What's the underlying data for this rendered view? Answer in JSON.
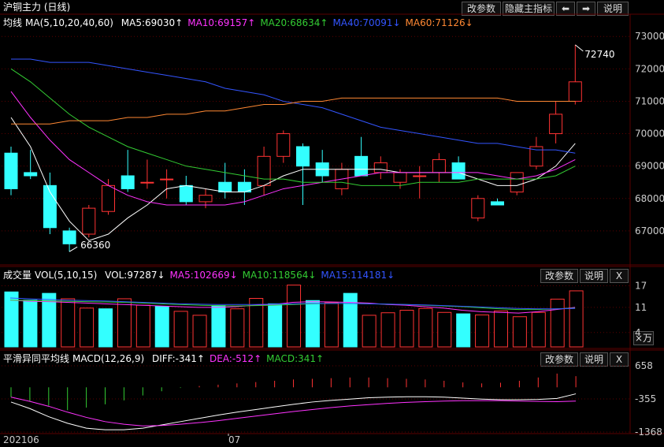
{
  "main": {
    "title": "沪铜主力 (日线)",
    "buttons": {
      "params": "改参数",
      "hide": "隐藏主指标",
      "explain": "说明"
    },
    "indicator": {
      "label": "均线",
      "params": "MA(5,10,20,40,60)",
      "items": [
        {
          "text": "MA5:69030↑",
          "color": "#ffffff"
        },
        {
          "text": "MA10:69157↑",
          "color": "#ff33ff"
        },
        {
          "text": "MA20:68634↑",
          "color": "#33cc33"
        },
        {
          "text": "MA40:70091↓",
          "color": "#3355ff"
        },
        {
          "text": "MA60:71126↓",
          "color": "#ff8833"
        }
      ]
    },
    "annotations": {
      "high": "72740",
      "low": "66360"
    }
  },
  "volume": {
    "title": "成交量",
    "params": "VOL(5,10,15)",
    "items": [
      {
        "text": "VOL:97287↓",
        "color": "#ffffff"
      },
      {
        "text": "MA5:102669↓",
        "color": "#ff33ff"
      },
      {
        "text": "MA10:118564↓",
        "color": "#33cc33"
      },
      {
        "text": "MA15:114181↓",
        "color": "#3355ff"
      }
    ],
    "buttons": {
      "params": "改参数",
      "explain": "说明",
      "close": "X",
      "unit": "×万"
    }
  },
  "macd": {
    "title": "平滑异同平均线",
    "params": "MACD(12,26,9)",
    "items": [
      {
        "text": "DIFF:-341↑",
        "color": "#ffffff"
      },
      {
        "text": "DEA:-512↑",
        "color": "#ff33ff"
      },
      {
        "text": "MACD:341↑",
        "color": "#33cc33"
      }
    ],
    "buttons": {
      "params": "改参数",
      "explain": "说明",
      "close": "X"
    }
  },
  "x_labels": [
    "202106",
    "07"
  ],
  "chart_data": [
    {
      "type": "candlestick",
      "ylim": [
        66000,
        73200
      ],
      "y_ticks": [
        67000,
        68000,
        69000,
        70000,
        71000,
        72000,
        73000
      ],
      "colors": {
        "up": "#ff3333",
        "down": "#33ffff",
        "grid": "#5a0000"
      },
      "candles": [
        {
          "o": 69400,
          "h": 69600,
          "l": 68100,
          "c": 68300
        },
        {
          "o": 68800,
          "h": 69500,
          "l": 68600,
          "c": 68700
        },
        {
          "o": 68400,
          "h": 68800,
          "l": 66900,
          "c": 67100
        },
        {
          "o": 67000,
          "h": 67100,
          "l": 66360,
          "c": 66600
        },
        {
          "o": 66900,
          "h": 67800,
          "l": 66800,
          "c": 67700
        },
        {
          "o": 67600,
          "h": 68600,
          "l": 67500,
          "c": 68400
        },
        {
          "o": 68700,
          "h": 69500,
          "l": 68200,
          "c": 68300
        },
        {
          "o": 68500,
          "h": 69200,
          "l": 68300,
          "c": 68500
        },
        {
          "o": 68600,
          "h": 68900,
          "l": 68000,
          "c": 68600
        },
        {
          "o": 68400,
          "h": 68700,
          "l": 67800,
          "c": 67900
        },
        {
          "o": 67900,
          "h": 68300,
          "l": 67700,
          "c": 68100
        },
        {
          "o": 68500,
          "h": 69100,
          "l": 68000,
          "c": 68200
        },
        {
          "o": 68500,
          "h": 68900,
          "l": 67800,
          "c": 68200
        },
        {
          "o": 68400,
          "h": 69600,
          "l": 68100,
          "c": 69300
        },
        {
          "o": 69300,
          "h": 70100,
          "l": 69100,
          "c": 70000
        },
        {
          "o": 69600,
          "h": 69700,
          "l": 67800,
          "c": 69000
        },
        {
          "o": 69100,
          "h": 69500,
          "l": 68500,
          "c": 68700
        },
        {
          "o": 68300,
          "h": 69100,
          "l": 68100,
          "c": 68900
        },
        {
          "o": 69300,
          "h": 69900,
          "l": 68800,
          "c": 68700
        },
        {
          "o": 68800,
          "h": 69300,
          "l": 68600,
          "c": 69100
        },
        {
          "o": 68500,
          "h": 68900,
          "l": 68300,
          "c": 68800
        },
        {
          "o": 68700,
          "h": 69000,
          "l": 68000,
          "c": 68700
        },
        {
          "o": 68800,
          "h": 69400,
          "l": 68500,
          "c": 69200
        },
        {
          "o": 69100,
          "h": 69300,
          "l": 68600,
          "c": 68600
        },
        {
          "o": 67400,
          "h": 68100,
          "l": 67300,
          "c": 68000
        },
        {
          "o": 67900,
          "h": 68000,
          "l": 67800,
          "c": 67800
        },
        {
          "o": 68200,
          "h": 68800,
          "l": 68100,
          "c": 68800
        },
        {
          "o": 69000,
          "h": 69900,
          "l": 68900,
          "c": 69600
        },
        {
          "o": 70000,
          "h": 71000,
          "l": 69700,
          "c": 70600
        },
        {
          "o": 71000,
          "h": 72740,
          "l": 70900,
          "c": 71600
        }
      ],
      "ma": {
        "MA5": [
          70500,
          69600,
          68200,
          67300,
          66700,
          66900,
          67400,
          67800,
          68300,
          68400,
          68300,
          68200,
          68200,
          68400,
          68700,
          68900,
          68900,
          68900,
          68900,
          68900,
          68800,
          68800,
          68800,
          68800,
          68600,
          68400,
          68400,
          68600,
          69000,
          69700
        ],
        "MA10": [
          71300,
          70500,
          69800,
          69200,
          68800,
          68400,
          68100,
          67900,
          67800,
          67800,
          67800,
          67800,
          67900,
          68100,
          68300,
          68400,
          68500,
          68600,
          68700,
          68800,
          68800,
          68800,
          68800,
          68800,
          68800,
          68700,
          68600,
          68700,
          68900,
          69200
        ],
        "MA20": [
          72000,
          71600,
          71100,
          70600,
          70200,
          69900,
          69600,
          69400,
          69200,
          69000,
          68900,
          68800,
          68700,
          68600,
          68600,
          68500,
          68500,
          68500,
          68400,
          68400,
          68400,
          68500,
          68500,
          68500,
          68600,
          68600,
          68600,
          68600,
          68700,
          69000
        ],
        "MA40": [
          72300,
          72300,
          72200,
          72200,
          72200,
          72100,
          72000,
          71900,
          71800,
          71700,
          71600,
          71400,
          71300,
          71200,
          71000,
          70900,
          70800,
          70600,
          70400,
          70200,
          70100,
          70000,
          69900,
          69800,
          69700,
          69700,
          69600,
          69500,
          69500,
          69400
        ],
        "MA60": [
          70300,
          70300,
          70300,
          70400,
          70400,
          70400,
          70500,
          70500,
          70600,
          70600,
          70700,
          70700,
          70800,
          70900,
          70900,
          71000,
          71000,
          71100,
          71100,
          71100,
          71100,
          71100,
          71100,
          71100,
          71100,
          71100,
          71000,
          71000,
          71000,
          71000
        ]
      }
    },
    {
      "type": "bar",
      "ylim": [
        0,
        18
      ],
      "y_ticks": [
        4,
        11,
        17
      ],
      "values": [
        15.3,
        13.0,
        14.9,
        13.4,
        10.8,
        10.6,
        13.4,
        11.6,
        11.3,
        9.9,
        8.8,
        11.5,
        10.6,
        13.5,
        12.0,
        17.2,
        12.9,
        12.3,
        14.9,
        8.8,
        9.5,
        10.2,
        10.7,
        9.6,
        9.2,
        8.9,
        10.0,
        8.4,
        9.6,
        13.3,
        15.6
      ],
      "ma": {
        "MA5": [
          13.0,
          12.7,
          12.6,
          12.4,
          12.2,
          12.0,
          11.8,
          11.6,
          11.4,
          11.2,
          11.0,
          11.0,
          11.2,
          11.6,
          11.8,
          12.4,
          12.6,
          12.5,
          12.4,
          12.2,
          11.8,
          11.6,
          11.2,
          10.8,
          10.2,
          9.8,
          9.6,
          9.4,
          9.8,
          10.4,
          11.0
        ],
        "MA10": [
          13.0,
          12.9,
          12.8,
          12.7,
          12.6,
          12.5,
          12.4,
          12.2,
          12.0,
          11.8,
          11.6,
          11.5,
          11.4,
          11.5,
          11.6,
          11.8,
          12.0,
          12.1,
          12.1,
          12.0,
          11.9,
          11.8,
          11.6,
          11.4,
          11.2,
          10.9,
          10.6,
          10.4,
          10.4,
          10.6,
          10.8
        ],
        "MA15": [
          13.6,
          13.4,
          13.2,
          13.0,
          12.9,
          12.8,
          12.6,
          12.4,
          12.2,
          12.0,
          11.9,
          11.8,
          11.8,
          11.8,
          11.9,
          12.0,
          12.1,
          12.1,
          12.1,
          12.0,
          11.9,
          11.8,
          11.7,
          11.5,
          11.3,
          11.1,
          10.9,
          10.7,
          10.6,
          10.6,
          10.7
        ]
      }
    },
    {
      "type": "bar",
      "ylim": [
        -1368,
        658
      ],
      "y_ticks": [
        -1368,
        -355,
        658
      ],
      "macd": [
        -300,
        -420,
        -560,
        -700,
        -620,
        -520,
        -400,
        -250,
        -120,
        -20,
        40,
        80,
        120,
        160,
        200,
        240,
        260,
        280,
        300,
        300,
        280,
        260,
        240,
        200,
        150,
        120,
        140,
        200,
        300,
        420,
        341
      ],
      "diff": [
        -450,
        -650,
        -900,
        -1100,
        -1250,
        -1300,
        -1300,
        -1250,
        -1150,
        -1050,
        -950,
        -850,
        -760,
        -680,
        -600,
        -520,
        -450,
        -400,
        -360,
        -320,
        -300,
        -290,
        -290,
        -300,
        -330,
        -360,
        -380,
        -380,
        -370,
        -340,
        -200
      ],
      "dea": [
        -300,
        -430,
        -580,
        -760,
        -920,
        -1050,
        -1130,
        -1180,
        -1170,
        -1130,
        -1080,
        -1020,
        -950,
        -880,
        -810,
        -740,
        -680,
        -620,
        -570,
        -530,
        -490,
        -460,
        -440,
        -420,
        -410,
        -410,
        -410,
        -420,
        -430,
        -440,
        -420
      ]
    }
  ]
}
